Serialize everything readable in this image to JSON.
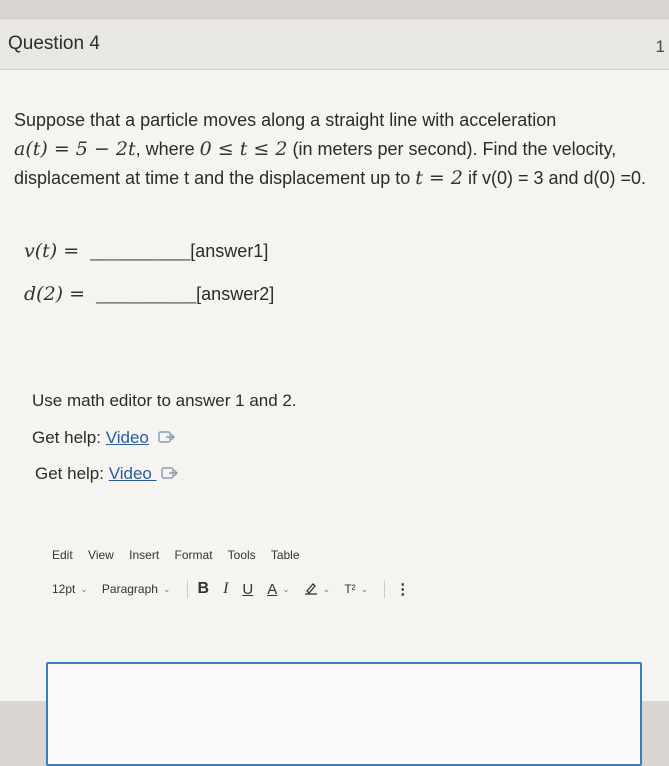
{
  "question": {
    "title": "Question 4",
    "points": "1"
  },
  "prompt": {
    "line1": "Suppose that a particle moves along a straight line with acceleration",
    "accel_math": "a(t) = 5 − 2t",
    "line2_a": ", where ",
    "range_math": "0 ≤ t ≤ 2",
    "line2_b": " (in meters per second). Find the velocity,",
    "line3_a": "displacement at time t and the displacement up to ",
    "t_math": "t = 2",
    "line3_b": " if v(0) = 3 and d(0) =0."
  },
  "answers": [
    {
      "lhs": "v(t) =",
      "blank": "__________",
      "tag": "[answer1]"
    },
    {
      "lhs": "d(2) =",
      "blank": "__________",
      "tag": "[answer2]"
    }
  ],
  "note": "Use math editor to answer 1 and 2.",
  "help": [
    {
      "label": "Get help: ",
      "link": "Video"
    },
    {
      "label": "Get help: ",
      "link": "Video "
    }
  ],
  "editor": {
    "menu": [
      "Edit",
      "View",
      "Insert",
      "Format",
      "Tools",
      "Table"
    ],
    "font_size": "12pt",
    "block_format": "Paragraph",
    "bold": "B",
    "italic": "I",
    "underline": "U",
    "text_color": "A",
    "superscript": "T²",
    "more": "⋮"
  },
  "colors": {
    "link": "#2a5c9a",
    "editor_border": "#3b7cc4"
  }
}
